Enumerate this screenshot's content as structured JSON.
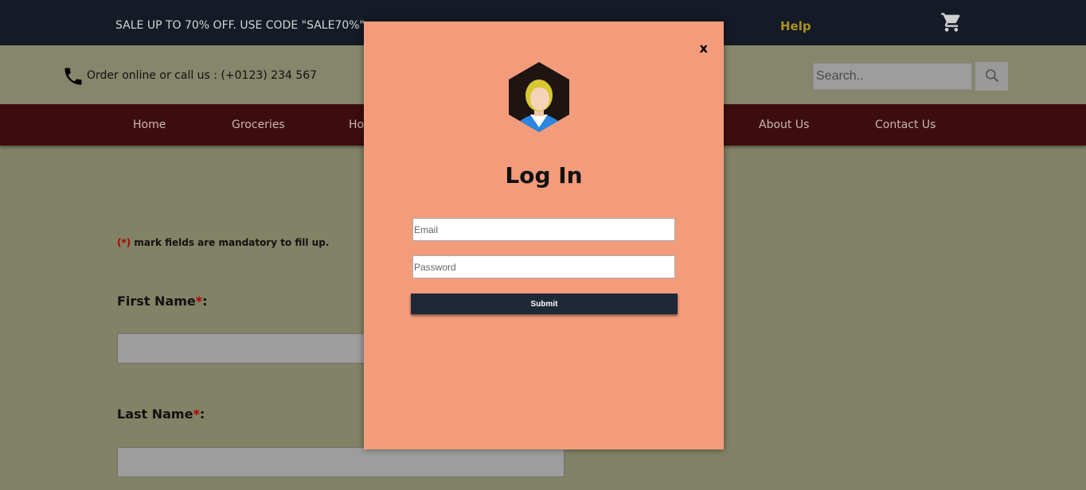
{
  "topbar": {
    "sale_text": "SALE UP TO 70% OFF. USE CODE \"SALE70%\".",
    "help_label": "Help",
    "cart_icon": "cart-icon",
    "help_color": "#a8911e"
  },
  "contact": {
    "phone_icon": "phone-icon",
    "text": "Order online or call us : (+0123) 234 567"
  },
  "search": {
    "placeholder": "Search..",
    "button_icon": "search-icon"
  },
  "nav": {
    "items": [
      {
        "label": "Home"
      },
      {
        "label": "Groceries"
      },
      {
        "label": "Ho"
      },
      {
        "label": "About Us"
      },
      {
        "label": "Contact Us"
      }
    ]
  },
  "form": {
    "mandatory_star": "(*)",
    "mandatory_text": " mark fields are mandatory to fill up.",
    "first_name_label": "First Name",
    "last_name_label": "Last Name",
    "required_mark": "*",
    "colon": ":"
  },
  "modal": {
    "close_label": "x",
    "title": "Log In",
    "email_placeholder": "Email",
    "password_placeholder": "Password",
    "submit_label": "Submit",
    "avatar_icon": "user-avatar-icon",
    "background_color": "#f29c7c"
  }
}
